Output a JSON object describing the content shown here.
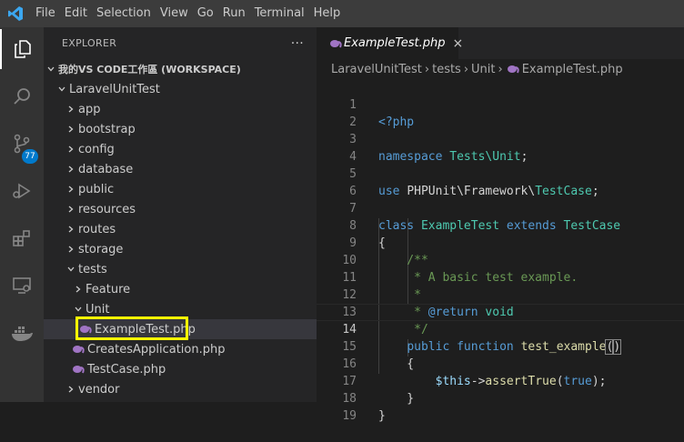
{
  "menu": [
    "File",
    "Edit",
    "Selection",
    "View",
    "Go",
    "Run",
    "Terminal",
    "Help"
  ],
  "activity": {
    "items": [
      "files-icon",
      "search-icon",
      "source-control-icon",
      "run-debug-icon",
      "extensions-icon",
      "remote-explorer-icon",
      "docker-icon"
    ],
    "scm_badge": "77"
  },
  "sidebar": {
    "title": "EXPLORER",
    "more": "···",
    "workspace": "我的VS CODE工作區 (WORKSPACE)",
    "tree": [
      {
        "label": "LaravelUnitTest",
        "expanded": true
      },
      {
        "label": "app"
      },
      {
        "label": "bootstrap"
      },
      {
        "label": "config"
      },
      {
        "label": "database"
      },
      {
        "label": "public"
      },
      {
        "label": "resources"
      },
      {
        "label": "routes"
      },
      {
        "label": "storage"
      },
      {
        "label": "tests",
        "expanded": true
      },
      {
        "label": "Feature"
      },
      {
        "label": "Unit",
        "expanded": true
      },
      {
        "label": "ExampleTest.php",
        "selected": true
      },
      {
        "label": "CreatesApplication.php"
      },
      {
        "label": "TestCase.php"
      },
      {
        "label": "vendor"
      }
    ]
  },
  "editor": {
    "tab_label": "ExampleTest.php",
    "tab_close": "×",
    "breadcrumb": [
      "LaravelUnitTest",
      "tests",
      "Unit",
      "ExampleTest.php"
    ],
    "current_line": 14,
    "line_numbers": [
      "1",
      "2",
      "3",
      "4",
      "5",
      "6",
      "7",
      "8",
      "9",
      "10",
      "11",
      "12",
      "13",
      "14",
      "15",
      "16",
      "17",
      "18",
      "19"
    ]
  },
  "colors": {
    "highlight_box": "#ffff00",
    "php_icon": "#a074c4",
    "accent": "#007acc"
  }
}
